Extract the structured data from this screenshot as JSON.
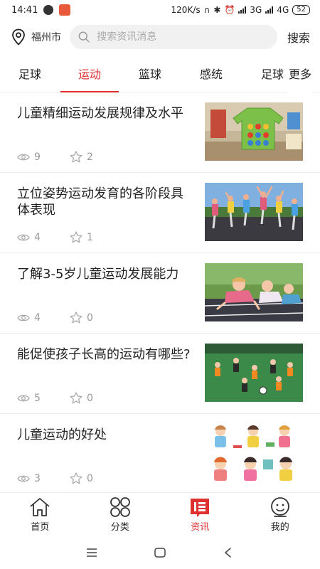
{
  "status_bar": {
    "time": "14:41",
    "speed": "120K/s",
    "network_3g": "3G",
    "network_4g": "4G",
    "battery": "52"
  },
  "header": {
    "city": "福州市",
    "search_placeholder": "搜索资讯消息",
    "search_button": "搜索"
  },
  "tabs": {
    "items": [
      {
        "label": "足球"
      },
      {
        "label": "运动"
      },
      {
        "label": "篮球"
      },
      {
        "label": "感统"
      },
      {
        "label": "足球"
      }
    ],
    "active_index": 1,
    "more_label": "更多"
  },
  "articles": [
    {
      "title": "儿童精细运动发展规律及水平",
      "views": "9",
      "stars": "2",
      "image": "lacing-toy"
    },
    {
      "title": "立位姿势运动发育的各阶段具体表现",
      "views": "4",
      "stars": "1",
      "image": "jumping-kids"
    },
    {
      "title": "了解3-5岁儿童运动发展能力",
      "views": "4",
      "stars": "0",
      "image": "crawling-kids"
    },
    {
      "title": "能促使孩子长高的运动有哪些?",
      "views": "5",
      "stars": "0",
      "image": "kids-football"
    },
    {
      "title": "儿童运动的好处",
      "views": "3",
      "stars": "0",
      "image": "cartoon-kids"
    }
  ],
  "bottom_nav": [
    {
      "label": "首页",
      "icon": "home-icon"
    },
    {
      "label": "分类",
      "icon": "category-icon"
    },
    {
      "label": "资讯",
      "icon": "news-icon"
    },
    {
      "label": "我的",
      "icon": "profile-icon"
    }
  ],
  "colors": {
    "accent": "#e03131",
    "text": "#222222",
    "muted": "#999999"
  }
}
